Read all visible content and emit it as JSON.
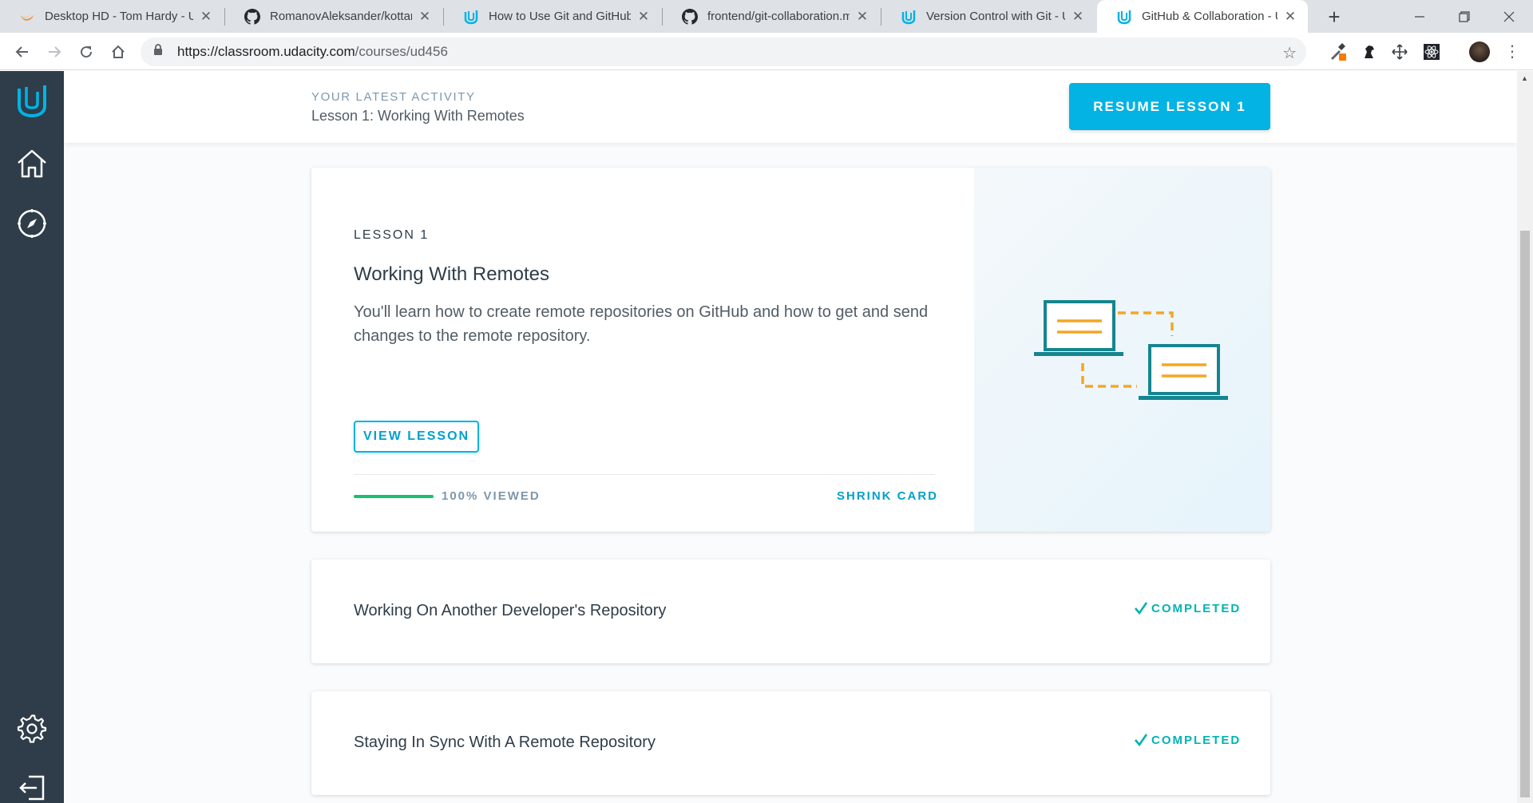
{
  "browser": {
    "tabs": [
      {
        "title": "Desktop HD - Tom Hardy - U",
        "icon": "swift-icon",
        "active": false
      },
      {
        "title": "RomanovAleksander/kottans",
        "icon": "github-icon",
        "active": false
      },
      {
        "title": "How to Use Git and GitHub",
        "icon": "udacity-icon",
        "active": false
      },
      {
        "title": "frontend/git-collaboration.m",
        "icon": "github-icon",
        "active": false
      },
      {
        "title": "Version Control with Git - Ud",
        "icon": "udacity-icon",
        "active": false
      },
      {
        "title": "GitHub & Collaboration - Ud",
        "icon": "udacity-icon",
        "active": true
      }
    ],
    "url_host": "https://classroom.udacity.com",
    "url_path": "/courses/ud456"
  },
  "sidenav": {
    "items": [
      "udacity-logo-icon",
      "home-icon",
      "compass-icon",
      "gear-icon",
      "logout-icon"
    ]
  },
  "activity": {
    "label": "YOUR LATEST ACTIVITY",
    "lesson": "Lesson 1: Working With Remotes",
    "resume_label": "RESUME LESSON 1"
  },
  "lesson_card": {
    "kicker": "LESSON 1",
    "title": "Working With Remotes",
    "description": "You'll learn how to create remote repositories on GitHub and how to get and send changes to the remote repository.",
    "view_label": "VIEW LESSON",
    "progress_percent": 100,
    "progress_text": "100% VIEWED",
    "shrink_label": "SHRINK CARD"
  },
  "concepts": [
    {
      "title": "Working On Another Developer's Repository",
      "status": "COMPLETED"
    },
    {
      "title": "Staying In Sync With A Remote Repository",
      "status": "COMPLETED"
    }
  ],
  "colors": {
    "accent": "#02b3e4",
    "sidebar": "#2e3d49",
    "progress": "#16c26b",
    "completed": "#02b3b3",
    "illustration_stroke": "#15858f",
    "illustration_accent": "#f5a623"
  }
}
